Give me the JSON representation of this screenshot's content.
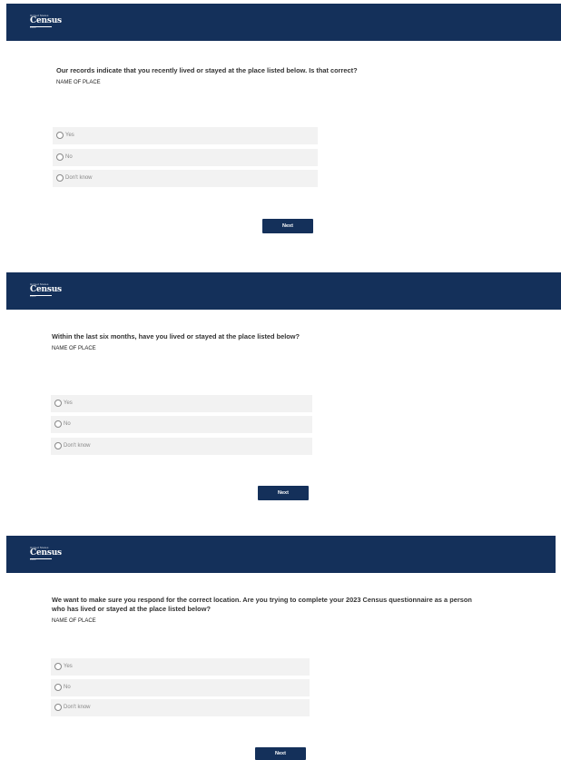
{
  "screens": [
    {
      "logo": {
        "top": "United States",
        "main": "Census",
        "sub": "Bureau"
      },
      "question": "Our records indicate that you recently lived or stayed at the place listed below. Is that correct?",
      "place": "NAME OF PLACE",
      "options": [
        "Yes",
        "No",
        "Don't know"
      ],
      "next_label": "Next"
    },
    {
      "logo": {
        "top": "United States",
        "main": "Census",
        "sub": "Bureau"
      },
      "question": "Within the last six months, have you lived or stayed at the place listed below?",
      "place": "NAME OF PLACE",
      "options": [
        "Yes",
        "No",
        "Don't know"
      ],
      "next_label": "Next"
    },
    {
      "logo": {
        "top": "United States",
        "main": "Census",
        "sub": "Bureau"
      },
      "question": "We want to make sure you respond for the correct location. Are you trying to complete your 2023 Census questionnaire as a person who has lived or stayed at the place listed below?",
      "place": "NAME OF PLACE",
      "options": [
        "Yes",
        "No",
        "Don't know"
      ],
      "next_label": "Next"
    }
  ]
}
